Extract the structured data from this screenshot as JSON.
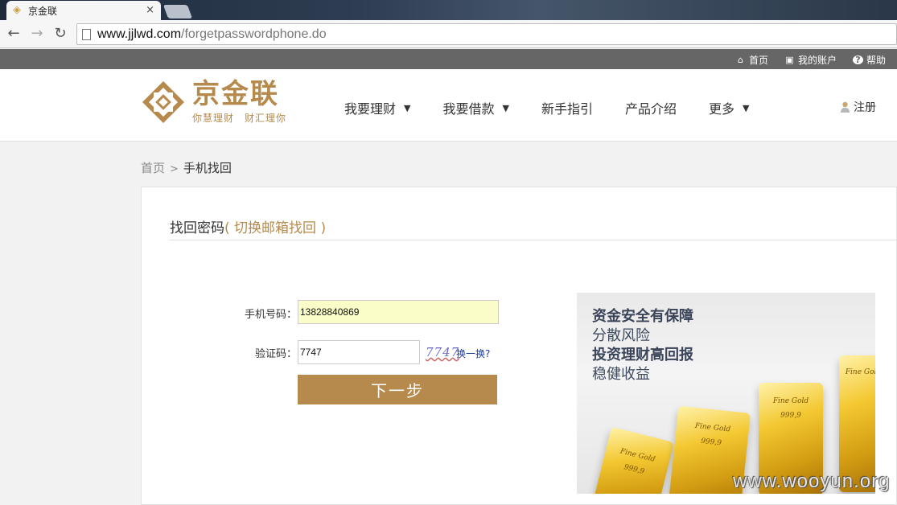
{
  "browser": {
    "tab_title": "京金联",
    "url_host": "www.jjlwd.com",
    "url_path": "/forgetpasswordphone.do"
  },
  "topbar": {
    "home": "首页",
    "account": "我的账户",
    "help": "帮助"
  },
  "logo": {
    "name": "京金联",
    "slogan": "你慧理财　财汇理你"
  },
  "nav": {
    "items": [
      {
        "label": "我要理财",
        "dropdown": true
      },
      {
        "label": "我要借款",
        "dropdown": true
      },
      {
        "label": "新手指引",
        "dropdown": false
      },
      {
        "label": "产品介绍",
        "dropdown": false
      },
      {
        "label": "更多",
        "dropdown": true
      }
    ],
    "register": "注册"
  },
  "breadcrumb": {
    "home": "首页",
    "separator": ">",
    "current": "手机找回"
  },
  "form": {
    "title": "找回密码",
    "switch_link": "( 切换邮箱找回 )",
    "phone_label": "手机号码：",
    "phone_value": "13828840869",
    "captcha_label": "验证码：",
    "captcha_value": "7747",
    "captcha_image_text": "7747",
    "refresh_link": "换一换?",
    "next_button": "下一步"
  },
  "promo": {
    "line1": "资金安全有保障",
    "line2": "分散风险",
    "line3": "投资理财高回报",
    "line4": "稳健收益",
    "bar_engraving": "Fine Gold",
    "bar_purity": "999,9"
  },
  "watermark": "www.wooyun.org",
  "colors": {
    "brand_gold": "#b58a4c",
    "topbar_gray": "#666666",
    "phone_input_bg": "#fbfdc9"
  }
}
